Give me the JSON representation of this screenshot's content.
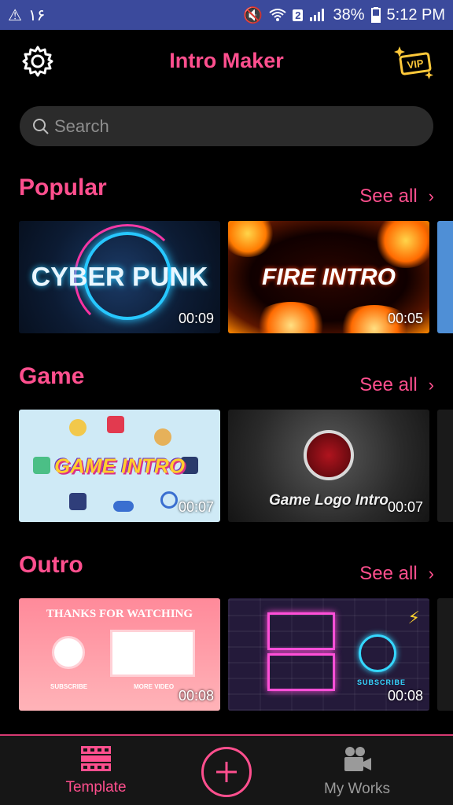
{
  "status_bar": {
    "left_text": "۱۶",
    "sim_badge": "2",
    "battery": "38%",
    "time": "5:12 PM"
  },
  "app_bar": {
    "title": "Intro Maker",
    "vip_label": "VIP"
  },
  "search": {
    "placeholder": "Search"
  },
  "sections": [
    {
      "title": "Popular",
      "see_all": "See all",
      "cards": [
        {
          "label": "CYBER PUNK",
          "duration": "00:09"
        },
        {
          "label": "FIRE INTRO",
          "duration": "00:05"
        }
      ]
    },
    {
      "title": "Game",
      "see_all": "See all",
      "cards": [
        {
          "label": "GAME INTRO",
          "duration": "00:07"
        },
        {
          "label": "Game Logo Intro",
          "duration": "00:07"
        }
      ]
    },
    {
      "title": "Outro",
      "see_all": "See all",
      "cards": [
        {
          "label": "THANKS FOR WATCHING",
          "duration": "00:08",
          "sub_left": "SUBSCRIBE",
          "sub_right": "MORE VIDEO"
        },
        {
          "label": "SUBSCRIBE",
          "duration": "00:08"
        }
      ]
    }
  ],
  "tab_bar": {
    "template_label": "Template",
    "my_works_label": "My Works"
  },
  "colors": {
    "accent": "#ff4f8e",
    "status_bar": "#3b4a9c",
    "background": "#000000",
    "search_bg": "#2b2b2b"
  }
}
